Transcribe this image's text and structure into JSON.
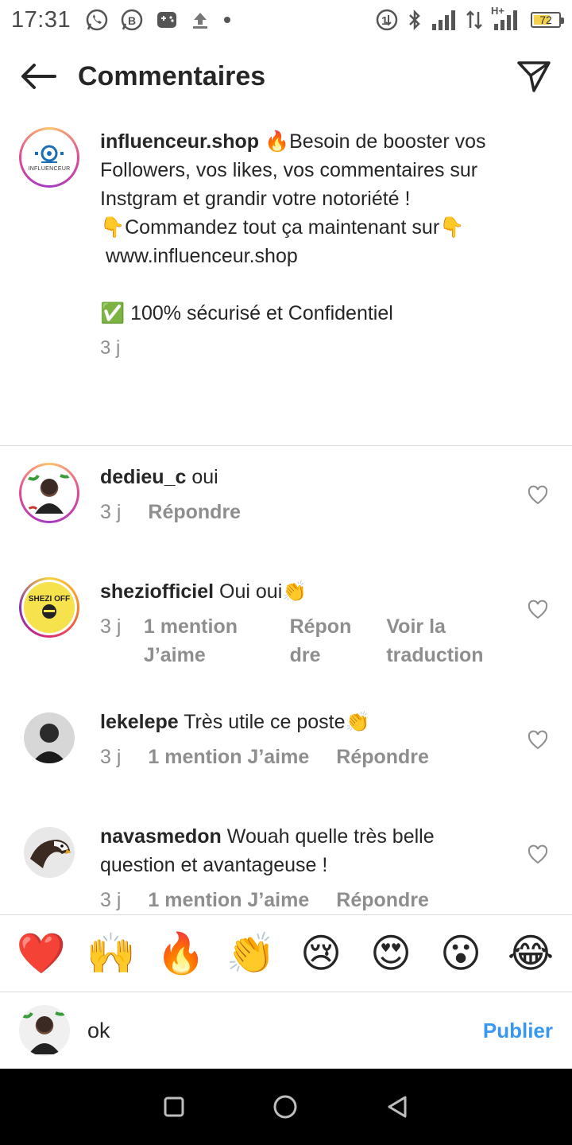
{
  "status_bar": {
    "time": "17:31",
    "left_icons": [
      "whatsapp-icon",
      "whatsapp-business-icon",
      "gamepad-icon",
      "upload-icon",
      "dot-icon"
    ],
    "right_icons": [
      "data-saver-icon",
      "bluetooth-icon",
      "signal-icon",
      "data-arrows-icon",
      "hplus-signal-icon"
    ],
    "network_label": "H+",
    "battery_level": "72",
    "battery_color": "#f3d34a"
  },
  "header": {
    "title": "Commentaires",
    "back_icon": "arrow-left-icon",
    "send_icon": "paper-plane-icon"
  },
  "caption": {
    "username": "influenceur.shop",
    "line1": "🔥Besoin de booster vos Followers, vos likes, vos commentaires sur Instgram et grandir votre notoriété !",
    "line2": "👇Commandez tout ça maintenant sur👇",
    "line3": " www.influenceur.shop",
    "line4": "✅ 100% sécurisé et Confidentiel",
    "age": "3 j",
    "avatar_label": "INFLUENCEUR"
  },
  "comments": [
    {
      "username": "dedieu_c",
      "text": "oui",
      "age": "3 j",
      "likes": "",
      "reply": "Répondre",
      "translate": ""
    },
    {
      "username": "sheziofficiel",
      "text": "Oui oui👏",
      "age": "3 j",
      "likes": "1 mention J’aime",
      "reply": "Répondre",
      "translate": "Voir la traduction",
      "avatar_label": "SHEZI OFF"
    },
    {
      "username": "lekelepe",
      "text": "Très utile ce poste👏",
      "age": "3 j",
      "likes": "1 mention J’aime",
      "reply": "Répondre",
      "translate": ""
    },
    {
      "username": "navasmedon",
      "text": "Wouah quelle très belle question et avantageuse !",
      "age": "3 j",
      "likes": "1 mention J’aime",
      "reply": "Répondre",
      "translate": ""
    }
  ],
  "emoji_bar": [
    "❤️",
    "🙌",
    "🔥",
    "👏",
    "😢",
    "😍",
    "😮",
    "😂"
  ],
  "input": {
    "value": "ok",
    "publish_label": "Publier"
  },
  "nav": [
    "square-icon",
    "circle-icon",
    "triangle-back-icon"
  ],
  "colors": {
    "accent": "#3897f0",
    "muted": "#8e8e8e",
    "text": "#262626"
  }
}
